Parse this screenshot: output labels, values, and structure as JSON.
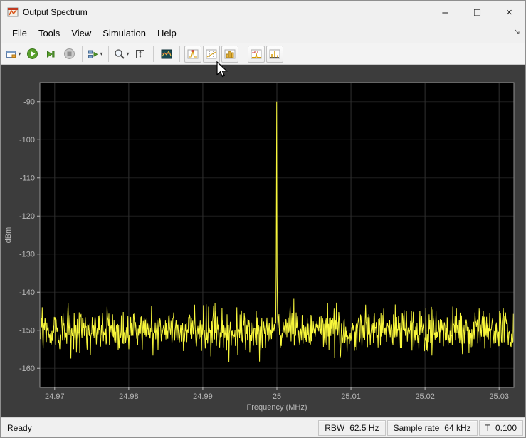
{
  "window": {
    "title": "Output Spectrum",
    "controls": [
      {
        "name": "minimize",
        "glyph": "–"
      },
      {
        "name": "maximize",
        "glyph": "□"
      },
      {
        "name": "close",
        "glyph": "×"
      }
    ]
  },
  "menu": {
    "items": [
      "File",
      "Tools",
      "View",
      "Simulation",
      "Help"
    ],
    "collapse_glyph": "↘"
  },
  "toolbar": {
    "dropdown_glyph": "▾",
    "buttons": [
      "scope-settings",
      "run",
      "step-forward",
      "stop",
      "simulation-step-options",
      "zoom",
      "scale-axes",
      "spectrum-settings",
      "peak-finder",
      "cursor-measurements",
      "signal-statistics",
      "spectral-mask",
      "distortion-measurements"
    ]
  },
  "statusbar": {
    "ready": "Ready",
    "cells": [
      "RBW=62.5 Hz",
      "Sample rate=64 kHz",
      "T=0.100"
    ]
  },
  "chart_data": {
    "type": "line",
    "title": "",
    "xlabel": "Frequency (MHz)",
    "ylabel": "dBm",
    "xlim": [
      24.968,
      25.032
    ],
    "ylim": [
      -165,
      -85
    ],
    "xticks": [
      24.97,
      24.98,
      24.99,
      25,
      25.01,
      25.02,
      25.03
    ],
    "yticks": [
      -90,
      -100,
      -110,
      -120,
      -130,
      -140,
      -150,
      -160
    ],
    "grid": true,
    "background": "#000000",
    "axes_color": "#b9b9b9",
    "series": [
      {
        "name": "output-spectrum",
        "color": "#f8f73b",
        "points": 1024,
        "noise_floor_dbm": -150,
        "noise_std_db": 2.7,
        "peak": {
          "x": 25,
          "y": -90
        }
      }
    ]
  }
}
